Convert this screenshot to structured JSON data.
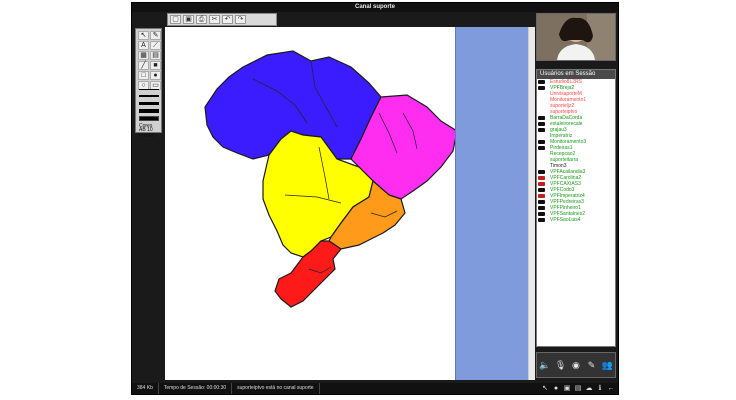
{
  "window": {
    "title": "Canal suporte"
  },
  "toolbar": {
    "buttons": [
      "new-page-icon",
      "save-icon",
      "print-icon",
      "cut-icon",
      "undo-icon",
      "redo-icon"
    ]
  },
  "tools": {
    "cores_label": "Cores",
    "ab_label": "AB",
    "font_size": "10",
    "fontes_label": "Fontes",
    "swatch_color": "#000000"
  },
  "users_panel": {
    "header": "Usuários em Sessão",
    "users": [
      {
        "name": "Estudio8L2RS",
        "color": "#ff4a4a",
        "mark": "black"
      },
      {
        "name": "VPFBreja2",
        "color": "#1a9a1a",
        "mark": "black"
      },
      {
        "name": "UnivisaporteM",
        "color": "#ff4a4a",
        "mark": ""
      },
      {
        "name": "Monitoramento1",
        "color": "#ff4a4a",
        "mark": ""
      },
      {
        "name": "suporteljz2",
        "color": "#ff4a4a",
        "mark": ""
      },
      {
        "name": "suporteiptvo",
        "color": "#ff4a4a",
        "mark": ""
      },
      {
        "name": "BarraDaCorda",
        "color": "#1a9a1a",
        "mark": "black"
      },
      {
        "name": "estaleirorecale",
        "color": "#1a9a1a",
        "mark": "black"
      },
      {
        "name": "grajau3",
        "color": "#1a9a1a",
        "mark": "black"
      },
      {
        "name": "Imperatriz",
        "color": "#1a9a1a",
        "mark": ""
      },
      {
        "name": "Monitoramento3",
        "color": "#1a9a1a",
        "mark": "black"
      },
      {
        "name": "Pirdeiras1",
        "color": "#1a9a1a",
        "mark": "black"
      },
      {
        "name": "Recepcao2",
        "color": "#1a9a1a",
        "mark": ""
      },
      {
        "name": "suporteitarra",
        "color": "#1a9a1a",
        "mark": ""
      },
      {
        "name": "Timon3",
        "color": "#1a1a1a",
        "mark": ""
      },
      {
        "name": "VPFAcailandia3",
        "color": "#1a9a1a",
        "mark": "black"
      },
      {
        "name": "VPFCarolina2",
        "color": "#1a9a1a",
        "mark": "red"
      },
      {
        "name": "VPFCAXIAS3",
        "color": "#1a9a1a",
        "mark": "red"
      },
      {
        "name": "VPFCodo3",
        "color": "#1a9a1a",
        "mark": "black"
      },
      {
        "name": "VPFImperatriz4",
        "color": "#1a9a1a",
        "mark": "red"
      },
      {
        "name": "VPFPedreiras3",
        "color": "#1a9a1a",
        "mark": "black"
      },
      {
        "name": "VPFPinheiro1",
        "color": "#1a9a1a",
        "mark": "black"
      },
      {
        "name": "VPFSantaInes2",
        "color": "#1a9a1a",
        "mark": "black"
      },
      {
        "name": "VPFSaoLuis4",
        "color": "#1a9a1a",
        "mark": "black"
      }
    ]
  },
  "controls": {
    "icons": [
      "speaker-icon",
      "microphone-icon",
      "webcam-icon",
      "chat-icon",
      "users-icon"
    ]
  },
  "status": {
    "size": "384 Kb",
    "session_time_label": "Tempo de Sessão: 00:00:30",
    "message": "suporteiptvo está no canal suporte"
  },
  "status_icons": [
    "pointer-icon",
    "record-icon",
    "document-icon",
    "slideshow-icon",
    "cloud-icon",
    "info-icon",
    "back-icon"
  ],
  "map": {
    "region_colors": {
      "north": "#3b1cff",
      "northeast": "#ff2df0",
      "central_west": "#ffff00",
      "southeast": "#ff9a1a",
      "south": "#ff1a1a"
    }
  }
}
